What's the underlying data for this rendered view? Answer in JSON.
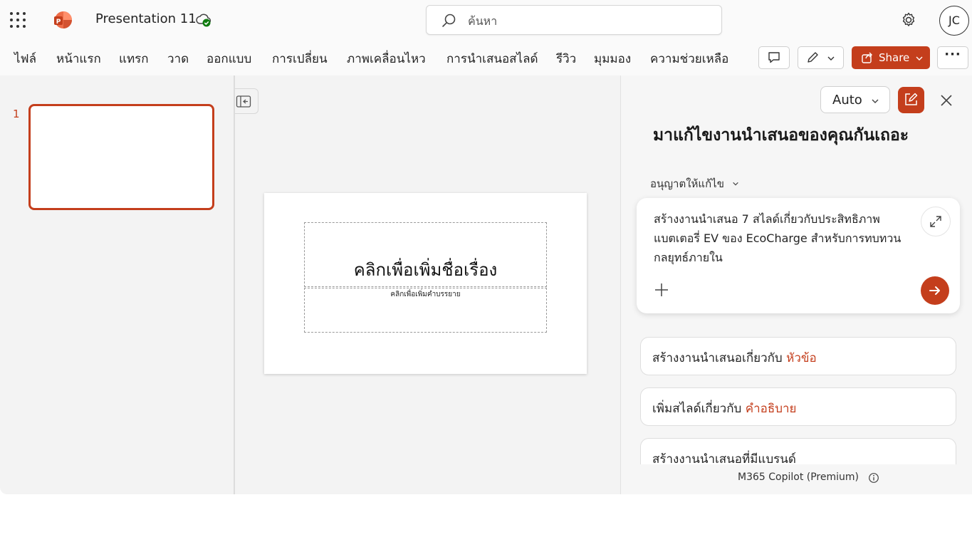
{
  "app": {
    "title": "Presentation 11",
    "user_initials": "JC",
    "accent_color": "#c43e1c"
  },
  "search": {
    "placeholder": "ค้นหา"
  },
  "menu": {
    "items": [
      "ไฟล์",
      "หน้าแรก",
      "แทรก",
      "วาด",
      "ออกแบบ",
      "การเปลี่ยน",
      "ภาพเคลื่อนไหว",
      "การนำเสนอสไลด์",
      "รีวิว",
      "มุมมอง",
      "ความช่วยเหลือ"
    ],
    "share_label": "Share",
    "more_label": "···"
  },
  "thumbnails": {
    "items": [
      {
        "number": "1"
      }
    ]
  },
  "slide": {
    "title_placeholder": "คลิกเพื่อเพิ่มชื่อเรื่อง",
    "subtitle_placeholder": "คลิกเพื่อเพิ่มคำบรรยาย"
  },
  "copilot": {
    "mode_label": "Auto",
    "heading": "มาแก้ไขงานนำเสนอของคุณกันเถอะ",
    "permission_label": "อนุญาตให้แก้ไข",
    "prompt_text": "สร้างงานนำเสนอ 7 สไลด์เกี่ยวกับประสิทธิภาพแบตเตอรี่ EV ของ EcoCharge สำหรับการทบทวนกลยุทธ์ภายใน",
    "suggestions": [
      {
        "prefix": "สร้างงานนำเสนอเกี่ยวกับ ",
        "highlight": "หัวข้อ"
      },
      {
        "prefix": "เพิ่มสไลด์เกี่ยวกับ ",
        "highlight": "คำอธิบาย"
      },
      {
        "prefix": "สร้างงานนำเสนอที่มีแบรนด์",
        "highlight": ""
      }
    ],
    "footer": "M365 Copilot (Premium)"
  }
}
